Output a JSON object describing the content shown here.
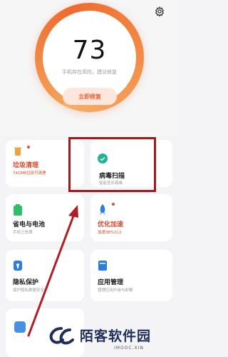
{
  "header": {
    "settings_icon": "gear-icon"
  },
  "score_panel": {
    "score": "73",
    "subtitle": "手机存在风险，建议修复",
    "repair_button": "立即修复",
    "ring_color": "#ee6b2f"
  },
  "cards": [
    {
      "title": "垃圾清理",
      "subtitle": "741MB垃圾可清理",
      "icon": "trash-icon",
      "title_color": "#d84a2c",
      "sub_color": "#d84a2c",
      "has_dot": true
    },
    {
      "title": "病毒扫描",
      "subtitle": "智能查杀病毒",
      "icon": "shield-check-icon",
      "title_color": "#222222",
      "sub_color": "#9a9a9a",
      "has_dot": false
    },
    {
      "title": "省电与电池",
      "subtitle": "手机已充满",
      "icon": "battery-icon",
      "title_color": "#222222",
      "sub_color": "#9a9a9a",
      "has_dot": false
    },
    {
      "title": "优化加速",
      "subtitle": "加速38%以上",
      "icon": "rocket-icon",
      "title_color": "#d84a2c",
      "sub_color": "#d84a2c",
      "has_dot": true
    },
    {
      "title": "隐私保护",
      "subtitle": "保护隐私数据安全",
      "icon": "privacy-icon",
      "title_color": "#222222",
      "sub_color": "#9a9a9a",
      "has_dot": false
    },
    {
      "title": "应用管理",
      "subtitle": "管理应用升级与卸载",
      "icon": "app-manage-icon",
      "title_color": "#222222",
      "sub_color": "#9a9a9a",
      "has_dot": false
    }
  ],
  "watermark": {
    "brand": "陌客软件园",
    "url": "IMOOC.XIN"
  }
}
